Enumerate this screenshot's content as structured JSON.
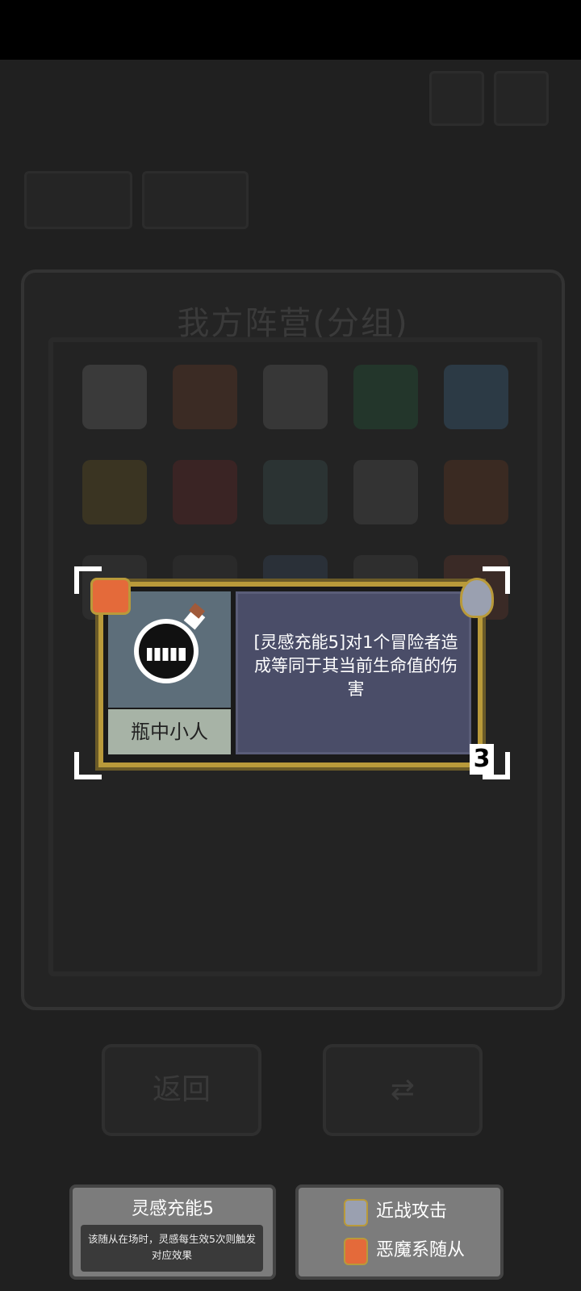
{
  "panel": {
    "title": "我方阵营(分组)"
  },
  "buttons": {
    "back": "返回",
    "swap_icon": "swap-icon"
  },
  "card": {
    "name": "瓶中小人",
    "description": "[灵感充能5]对1个冒险者造成等同于其当前生命值的伤害",
    "cost": "3",
    "portrait_icon": "bottle-imp-icon",
    "type_icon": "demon-icon",
    "attack_icon": "sword-icon"
  },
  "keyword": {
    "title": "灵感充能5",
    "description": "该随从在场时，灵感每生效5次则触发对应效果"
  },
  "legend": [
    {
      "icon": "sword-icon",
      "label": "近战攻击"
    },
    {
      "icon": "demon-icon",
      "label": "恶魔系随从"
    }
  ],
  "colors": {
    "card_border": "#b99a3a",
    "demon": "#e46a3a",
    "desc_bg": "#4a4d68"
  }
}
